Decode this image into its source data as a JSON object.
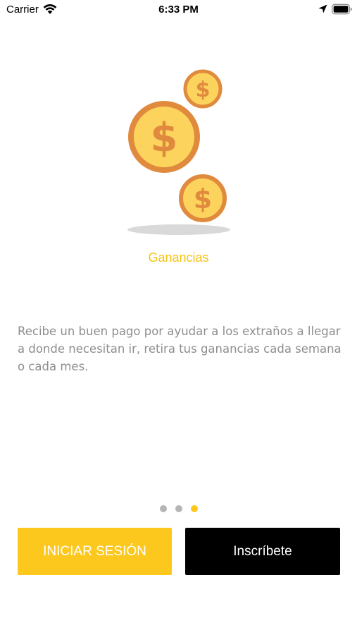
{
  "status_bar": {
    "carrier": "Carrier",
    "time": "6:33 PM",
    "icons": [
      "wifi-icon",
      "location-arrow-icon",
      "battery-icon"
    ]
  },
  "illustration": {
    "icon": "coins-icon",
    "coin_symbol": "$",
    "colors": {
      "coin_fill": "#fcd35c",
      "coin_border": "#e08a3e",
      "shadow": "#d9d9d9"
    }
  },
  "feature": {
    "title": "Ganancias",
    "description": "Recibe un buen pago por ayudar a los extraños a llegar a donde necesitan ir, retira tus ganancias cada semana o cada mes."
  },
  "pager": {
    "count": 3,
    "active_index": 2
  },
  "buttons": {
    "login_label": "INICIAR SESIÓN",
    "signup_label": "Inscríbete"
  },
  "colors": {
    "accent": "#fcc81e",
    "title": "#f6c312",
    "text_muted": "#8e8e8e",
    "signup_bg": "#000000"
  }
}
